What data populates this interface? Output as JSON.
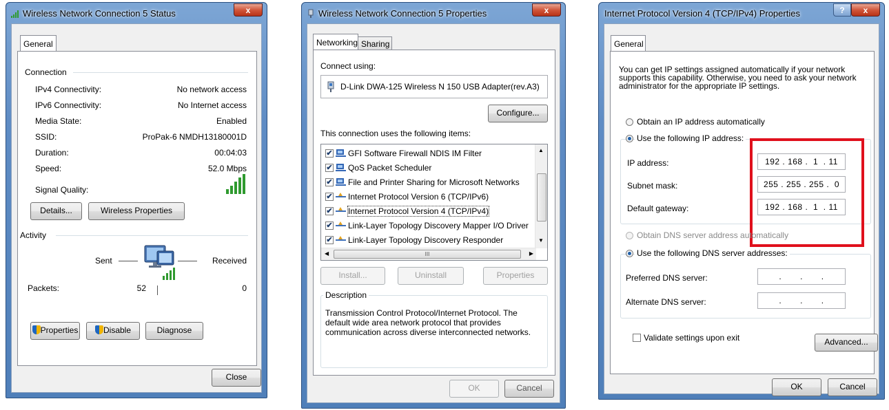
{
  "status_dialog": {
    "title": "Wireless Network Connection 5 Status",
    "close_glyph": "x",
    "tab_general": "General",
    "connection_group": "Connection",
    "rows": [
      {
        "label": "IPv4 Connectivity:",
        "value": "No network access"
      },
      {
        "label": "IPv6 Connectivity:",
        "value": "No Internet access"
      },
      {
        "label": "Media State:",
        "value": "Enabled"
      },
      {
        "label": "SSID:",
        "value": "ProPak-6 NMDH13180001D"
      },
      {
        "label": "Duration:",
        "value": "00:04:03"
      },
      {
        "label": "Speed:",
        "value": "52.0 Mbps"
      }
    ],
    "signal_quality_label": "Signal Quality:",
    "signal_bars_level": 5,
    "details_button": "Details...",
    "wireless_properties_button": "Wireless Properties",
    "activity_group": "Activity",
    "sent_label": "Sent",
    "received_label": "Received",
    "packets_label": "Packets:",
    "packets_sent": "52",
    "packets_received": "0",
    "properties_button": "Properties",
    "disable_button": "Disable",
    "diagnose_button": "Diagnose",
    "close_button": "Close"
  },
  "properties_dialog": {
    "title": "Wireless Network Connection 5 Properties",
    "close_glyph": "x",
    "tab_networking": "Networking",
    "tab_sharing": "Sharing",
    "connect_using_label": "Connect using:",
    "adapter_name": "D-Link DWA-125 Wireless N 150 USB Adapter(rev.A3)",
    "configure_button": "Configure...",
    "items_label": "This connection uses the following items:",
    "items": [
      {
        "label": "GFI Software Firewall NDIS IM Filter",
        "checked": true,
        "icon": "network-client-icon"
      },
      {
        "label": "QoS Packet Scheduler",
        "checked": true,
        "icon": "network-service-icon"
      },
      {
        "label": "File and Printer Sharing for Microsoft Networks",
        "checked": true,
        "icon": "network-service-icon"
      },
      {
        "label": "Internet Protocol Version 6 (TCP/IPv6)",
        "checked": true,
        "icon": "protocol-icon"
      },
      {
        "label": "Internet Protocol Version 4 (TCP/IPv4)",
        "checked": true,
        "icon": "protocol-icon"
      },
      {
        "label": "Link-Layer Topology Discovery Mapper I/O Driver",
        "checked": true,
        "icon": "protocol-icon"
      },
      {
        "label": "Link-Layer Topology Discovery Responder",
        "checked": true,
        "icon": "protocol-icon"
      }
    ],
    "check_glyph": "✔",
    "scroll_thumb_glyph": "III",
    "install_button": "Install...",
    "uninstall_button": "Uninstall",
    "properties_button": "Properties",
    "description_group": "Description",
    "description_text": "Transmission Control Protocol/Internet Protocol. The default wide area network protocol that provides communication across diverse interconnected networks.",
    "ok_button": "OK",
    "cancel_button": "Cancel"
  },
  "ipv4_dialog": {
    "title": "Internet Protocol Version 4 (TCP/IPv4) Properties",
    "help_glyph": "?",
    "close_glyph": "x",
    "tab_general": "General",
    "intro_text": "You can get IP settings assigned automatically if your network supports this capability. Otherwise, you need to ask your network administrator for the appropriate IP settings.",
    "obtain_ip_auto": "Obtain an IP address automatically",
    "use_following_ip": "Use the following IP address:",
    "ip_address_label": "IP address:",
    "ip_address_value": "192 . 168 .  1  . 11",
    "subnet_mask_label": "Subnet mask:",
    "subnet_mask_value": "255 . 255 . 255 .  0",
    "default_gateway_label": "Default gateway:",
    "default_gateway_value": "192 . 168 .  1  . 11",
    "obtain_dns_auto": "Obtain DNS server address automatically",
    "use_following_dns": "Use the following DNS server addresses:",
    "preferred_dns_label": "Preferred DNS server:",
    "preferred_dns_value": ".       .       .",
    "alternate_dns_label": "Alternate DNS server:",
    "alternate_dns_value": ".       .       .",
    "validate_label": "Validate settings upon exit",
    "advanced_button": "Advanced...",
    "ok_button": "OK",
    "cancel_button": "Cancel",
    "highlight_color": "#e0101c"
  }
}
